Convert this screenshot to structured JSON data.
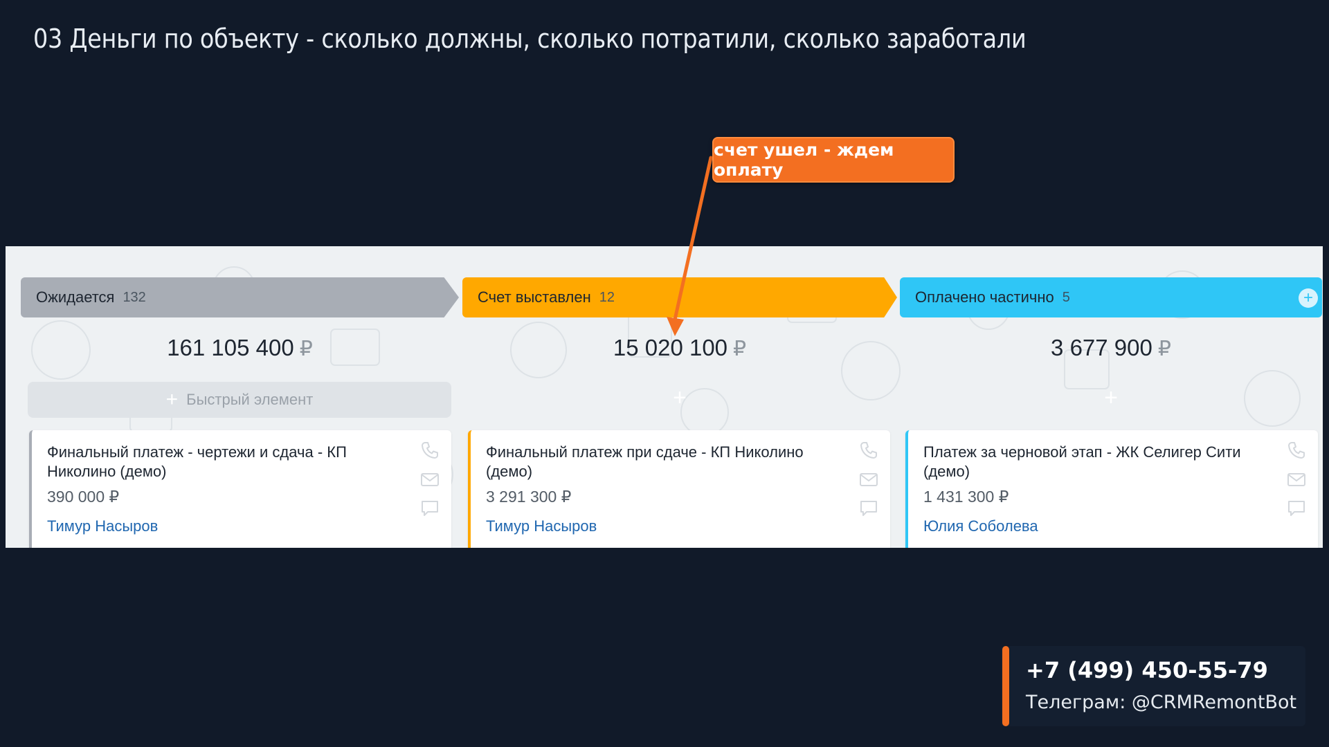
{
  "slide": {
    "title": "03 Деньги по объекту - сколько должны, сколько потратили, сколько заработали"
  },
  "callout": {
    "text": "счет ушел - ждем оплату"
  },
  "board": {
    "currency": "₽",
    "quick_add_label": "Быстрый элемент",
    "columns": [
      {
        "title": "Ожидается",
        "count": "132",
        "sum": "161 105 400",
        "color": "#a8adb5",
        "card": {
          "title": "Финальный платеж - чертежи и сдача - КП Николино (демо)",
          "amount": "390 000 ₽",
          "person": "Тимур Насыров"
        }
      },
      {
        "title": "Счет выставлен",
        "count": "12",
        "sum": "15 020 100",
        "color": "#ffa800",
        "card": {
          "title": "Финальный платеж при сдаче - КП Николино (демо)",
          "amount": "3 291 300 ₽",
          "person": "Тимур Насыров"
        }
      },
      {
        "title": "Оплачено частично",
        "count": "5",
        "sum": "3 677 900",
        "color": "#2fc6f6",
        "card": {
          "title": "Платеж за черновой этап - ЖК Селигер Сити (демо)",
          "amount": "1 431 300 ₽",
          "person": "Юлия Соболева"
        }
      }
    ],
    "card_icons": [
      "phone-icon",
      "envelope-icon",
      "chat-bubble-icon"
    ]
  },
  "contact": {
    "phone": "+7 (499) 450-55-79",
    "telegram": "Телеграм: @CRMRemontBot",
    "accent": "#f36f21"
  }
}
